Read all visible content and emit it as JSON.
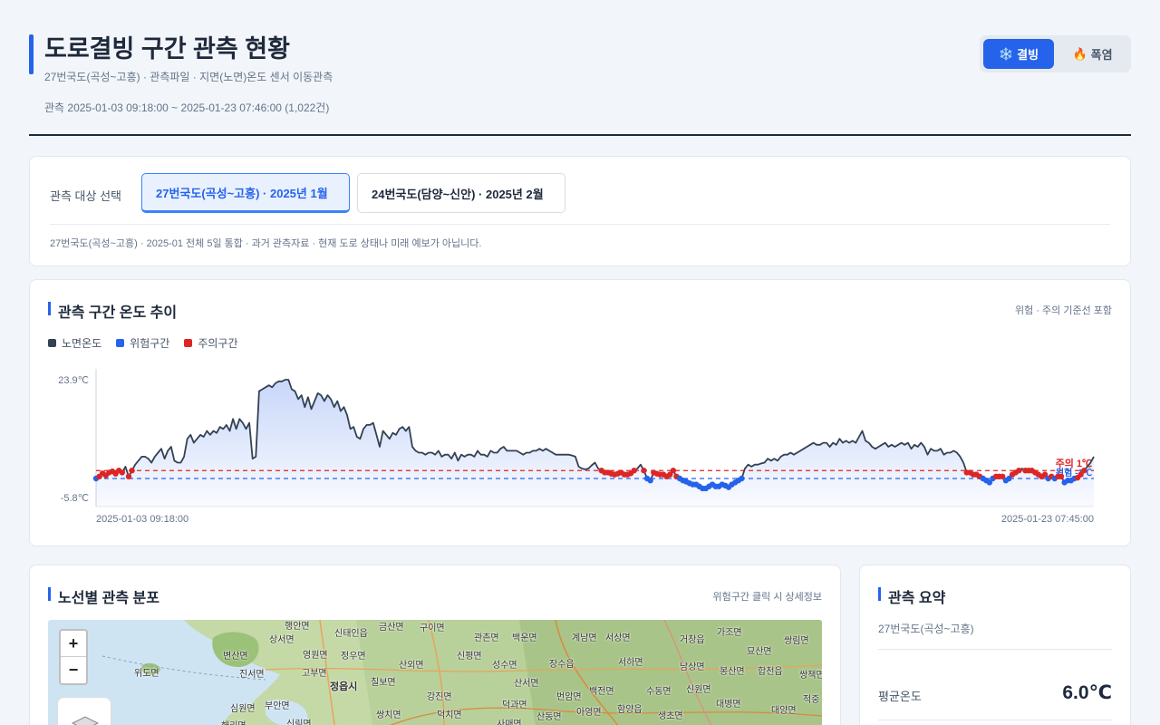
{
  "header": {
    "title": "도로결빙 구간 관측 현황",
    "subtitle": "27번국도(곡성~고흥) · 관측파일 · 지면(노면)온도 센서 이동관측",
    "range": "관측 2025-01-03 09:18:00 ~ 2025-01-23 07:46:00 (1,022건)",
    "modes": [
      {
        "icon": "❄️",
        "label": "결빙",
        "active": true
      },
      {
        "icon": "🔥",
        "label": "폭염",
        "active": false
      }
    ]
  },
  "selector": {
    "label": "관측 대상 선택",
    "options": [
      {
        "label": "27번국도(곡성~고흥) · 2025년 1월",
        "active": true
      },
      {
        "label": "24번국도(담양~신안) · 2025년 2월",
        "active": false
      }
    ],
    "note": "27번국도(곡성~고흥) · 2025-01 전체 5일 통합 · 과거 관측자료 · 현재 도로 상태나 미래 예보가 아닙니다."
  },
  "chart_section": {
    "title": "관측 구간 온도 추이",
    "hint": "위험 · 주의 기준선 포함",
    "legend": [
      {
        "label": "노면온도",
        "color": "#334155"
      },
      {
        "label": "위험구간",
        "color": "#2563eb"
      },
      {
        "label": "주의구간",
        "color": "#dc2626"
      }
    ]
  },
  "chart_data": {
    "type": "line",
    "ylim": [
      -5.8,
      23.9
    ],
    "y_ticks": [
      "23.9℃",
      "-5.8℃"
    ],
    "x_ticks": [
      "2025-01-03 09:18:00",
      "2025-01-23 07:45:00"
    ],
    "thresholds": [
      {
        "label": "주의 1℃",
        "value": 1,
        "color": "#dc2626"
      },
      {
        "label": "위험 -1℃",
        "value": -1,
        "color": "#2563eb"
      }
    ],
    "values": [
      -1.0,
      -0.5,
      0.3,
      -0.2,
      0.5,
      0.8,
      0.2,
      1.0,
      0.5,
      2.0,
      -0.5,
      1.0,
      2.5,
      3.5,
      4.5,
      4.5,
      4.0,
      3.0,
      4.5,
      5.5,
      6.5,
      4.0,
      6.0,
      7.0,
      3.5,
      3.0,
      3.0,
      4.5,
      9.0,
      10.0,
      8.0,
      9.0,
      10.0,
      9.5,
      11.0,
      10.0,
      11.0,
      10.5,
      12.0,
      11.5,
      12.5,
      11.0,
      14.0,
      11.5,
      14.0,
      13.0,
      11.5,
      13.0,
      4.0,
      4.5,
      21.0,
      21.5,
      22.0,
      22.5,
      22.0,
      23.0,
      23.5,
      23.5,
      23.9,
      23.9,
      21.5,
      21.0,
      19.0,
      20.0,
      17.0,
      19.5,
      16.5,
      18.5,
      20.5,
      20.0,
      18.5,
      20.0,
      19.0,
      17.0,
      18.5,
      16.0,
      17.0,
      15.0,
      11.5,
      12.0,
      9.5,
      9.0,
      11.5,
      12.5,
      12.5,
      13.0,
      10.0,
      7.0,
      11.0,
      10.0,
      9.0,
      10.5,
      10.0,
      11.5,
      12.0,
      11.0,
      12.0,
      7.0,
      6.0,
      5.5,
      5.5,
      5.0,
      5.5,
      5.5,
      5.0,
      6.0,
      4.5,
      5.0,
      5.0,
      4.0,
      5.5,
      3.5,
      5.0,
      4.5,
      5.0,
      5.0,
      4.5,
      6.0,
      5.0,
      5.0,
      4.5,
      6.0,
      5.5,
      5.5,
      6.5,
      7.0,
      6.0,
      6.0,
      6.0,
      6.0,
      5.5,
      5.0,
      5.5,
      5.5,
      6.0,
      6.0,
      6.5,
      6.0,
      6.5,
      6.0,
      5.5,
      5.0,
      5.0,
      5.0,
      5.0,
      5.0,
      4.8,
      4.5,
      2.0,
      1.5,
      1.3,
      1.5,
      2.3,
      3.0,
      1.5,
      1.0,
      0.5,
      0.5,
      0.2,
      0.0,
      0.2,
      0.5,
      0.0,
      0.0,
      0.3,
      1.0,
      1.5,
      2.5,
      1.0,
      -1.0,
      -1.5,
      0.5,
      0.2,
      0.0,
      0.0,
      -0.5,
      0.0,
      1.0,
      -0.5,
      -1.0,
      -1.5,
      -1.8,
      -2.2,
      -2.5,
      -2.5,
      -3.0,
      -3.5,
      -3.5,
      -3.0,
      -2.5,
      -3.0,
      -3.0,
      -2.5,
      -2.8,
      -3.2,
      -2.5,
      -2.0,
      -1.5,
      -1.0,
      1.5,
      2.5,
      2.0,
      2.5,
      2.5,
      2.8,
      3.0,
      4.0,
      3.5,
      4.0,
      3.5,
      4.5,
      5.0,
      5.0,
      5.5,
      5.0,
      5.5,
      6.0,
      6.5,
      7.0,
      7.5,
      8.0,
      7.5,
      7.5,
      8.0,
      8.0,
      7.0,
      8.0,
      7.5,
      9.0,
      8.0,
      8.5,
      8.0,
      8.5,
      8.0,
      9.5,
      11.0,
      8.5,
      8.0,
      7.0,
      6.5,
      7.0,
      7.5,
      8.0,
      7.0,
      7.5,
      7.0,
      7.5,
      8.0,
      7.5,
      8.0,
      6.5,
      7.5,
      7.0,
      8.0,
      7.0,
      5.0,
      6.5,
      6.0,
      6.0,
      6.5,
      5.0,
      5.5,
      5.5,
      6.0,
      5.5,
      4.5,
      3.0,
      0.5,
      0.5,
      0.0,
      0.0,
      -0.5,
      -1.0,
      -1.5,
      -2.0,
      -1.0,
      -0.5,
      -0.5,
      -0.5,
      -1.5,
      -1.0,
      0.0,
      0.5,
      1.0,
      1.5,
      1.0,
      1.0,
      1.0,
      0.5,
      0.0,
      -0.5,
      0.0,
      -1.0,
      -0.5,
      -1.0,
      -0.5,
      -0.5,
      -2.0,
      -1.5,
      -1.5,
      -1.0,
      -0.8,
      0.0,
      1.0,
      2.0,
      3.0,
      4.5
    ]
  },
  "map_section": {
    "title": "노선별 관측 분포",
    "hint": "위험구간 클릭 시 상세정보",
    "zoom_in": "+",
    "zoom_out": "−",
    "labels": [
      {
        "text": "행안면"
      },
      {
        "text": "상서면"
      },
      {
        "text": "신태인읍"
      },
      {
        "text": "금산면"
      },
      {
        "text": "구이면"
      },
      {
        "text": "관촌면"
      },
      {
        "text": "백운면"
      },
      {
        "text": "계남면"
      },
      {
        "text": "서상면"
      },
      {
        "text": "가조면"
      },
      {
        "text": "거창읍"
      },
      {
        "text": "묘산면"
      },
      {
        "text": "쌍림면"
      },
      {
        "text": "변산면"
      },
      {
        "text": "영원면"
      },
      {
        "text": "정우면"
      },
      {
        "text": "산외면"
      },
      {
        "text": "신평면"
      },
      {
        "text": "성수면"
      },
      {
        "text": "장수읍"
      },
      {
        "text": "서하면"
      },
      {
        "text": "남상면"
      },
      {
        "text": "봉산면"
      },
      {
        "text": "합천읍"
      },
      {
        "text": "쌍책면"
      },
      {
        "text": "위도면"
      },
      {
        "text": "진서면"
      },
      {
        "text": "고부면"
      },
      {
        "text": "칠보면"
      },
      {
        "text": "정읍시"
      },
      {
        "text": "산서면"
      },
      {
        "text": "수동면"
      },
      {
        "text": "신원면"
      },
      {
        "text": "대병면"
      },
      {
        "text": "대양면"
      },
      {
        "text": "적중"
      },
      {
        "text": "심원면"
      },
      {
        "text": "부안면"
      },
      {
        "text": "쌍치면"
      },
      {
        "text": "강진면"
      },
      {
        "text": "덕과면"
      },
      {
        "text": "번암면"
      },
      {
        "text": "백전면"
      },
      {
        "text": "해리면"
      },
      {
        "text": "신림면"
      },
      {
        "text": "덕치면"
      },
      {
        "text": "사매면"
      },
      {
        "text": "산동면"
      },
      {
        "text": "아영면"
      },
      {
        "text": "함양읍"
      },
      {
        "text": "생초면"
      }
    ]
  },
  "summary": {
    "title": "관측 요약",
    "subtitle": "27번국도(곡성~고흥)",
    "avg_label": "평균온도",
    "avg_value": "6.0℃"
  }
}
